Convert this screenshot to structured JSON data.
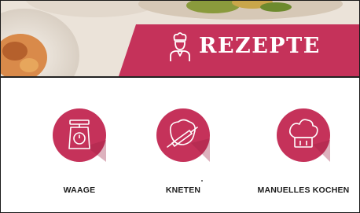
{
  "header": {
    "title": "REZEPTE",
    "icon": "chef-icon",
    "accent_color": "#c5325a"
  },
  "tiles": [
    {
      "label": "WAAGE",
      "icon": "scale-icon"
    },
    {
      "label": "KNETEN",
      "icon": "kneading-icon"
    },
    {
      "label": "MANUELLES KOCHEN",
      "icon": "chef-hat-icon"
    }
  ]
}
